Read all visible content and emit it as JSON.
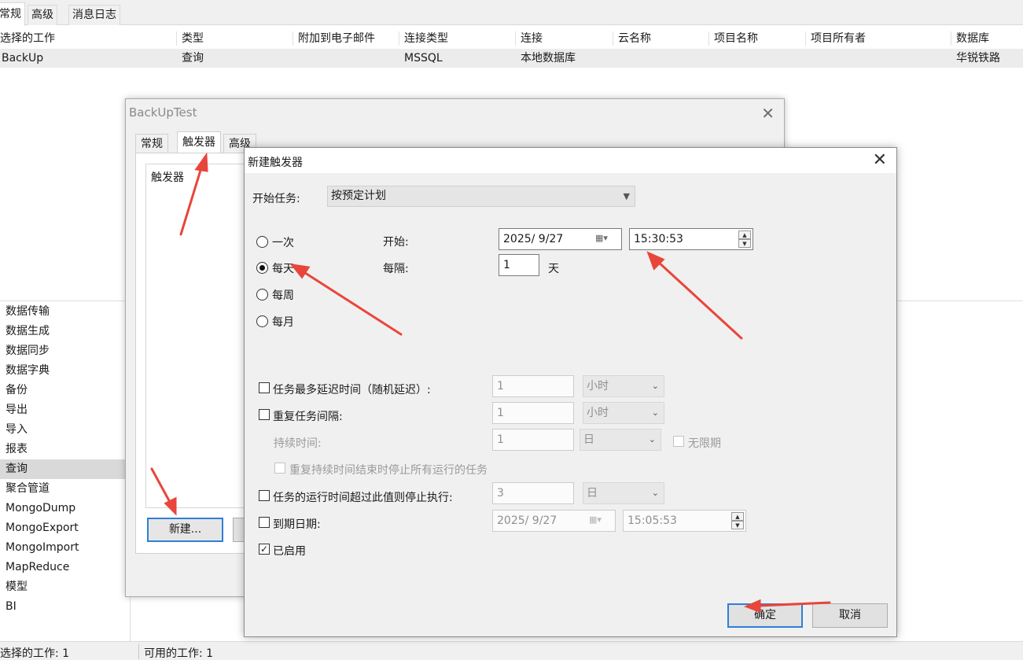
{
  "main_tabs": [
    "常规",
    "高级",
    "消息日志"
  ],
  "job_table": {
    "columns": [
      "选择的工作",
      "类型",
      "附加到电子邮件",
      "连接类型",
      "连接",
      "云名称",
      "项目名称",
      "项目所有者",
      "数据库"
    ],
    "rows": [
      [
        "BackUp",
        "查询",
        "",
        "MSSQL",
        "本地数据库",
        "",
        "",
        "",
        "华锐铁路"
      ]
    ]
  },
  "nav_items": [
    "数据传输",
    "数据生成",
    "数据同步",
    "数据字典",
    "备份",
    "导出",
    "导入",
    "报表",
    "查询",
    "聚合管道",
    "MongoDump",
    "MongoExport",
    "MongoImport",
    "MapReduce",
    "模型",
    "BI"
  ],
  "nav_selected": "查询",
  "status": {
    "selected": "选择的工作: 1",
    "available": "可用的工作: 1"
  },
  "dialog1": {
    "title": "BackUpTest",
    "tabs": [
      "常规",
      "触发器",
      "高级"
    ],
    "active_tab": "触发器",
    "list_title": "触发器",
    "new_button": "新建..."
  },
  "dialog2": {
    "title": "新建触发器",
    "begin_task_label": "开始任务:",
    "begin_task_value": "按预定计划",
    "schedule_options": [
      "一次",
      "每天",
      "每周",
      "每月"
    ],
    "schedule_selected": "每天",
    "start_label": "开始:",
    "start_date": "2025/  9/27",
    "start_time": "15:30:53",
    "every_label": "每隔:",
    "every_value": "1",
    "every_unit": "天",
    "delay": {
      "label": "任务最多延迟时间（随机延迟）:",
      "value": "1",
      "unit": "小时",
      "checked": false
    },
    "repeat": {
      "label": "重复任务间隔:",
      "value": "1",
      "unit": "小时",
      "checked": false
    },
    "duration": {
      "label": "持续时间:",
      "value": "1",
      "unit": "日",
      "indefinite_label": "无限期"
    },
    "stop_all_label": "重复持续时间结束时停止所有运行的任务",
    "stop_if_longer": {
      "label": "任务的运行时间超过此值则停止执行:",
      "value": "3",
      "unit": "日",
      "checked": false
    },
    "expire": {
      "label": "到期日期:",
      "date": "2025/  9/27",
      "time": "15:05:53",
      "checked": false
    },
    "enabled": {
      "label": "已启用",
      "checked": true
    },
    "ok_button": "确定",
    "cancel_button": "取消"
  },
  "colors": {
    "accent": "#2f7fd6",
    "annotation_arrow": "#e8463b",
    "selection": "#d9d9d9"
  }
}
